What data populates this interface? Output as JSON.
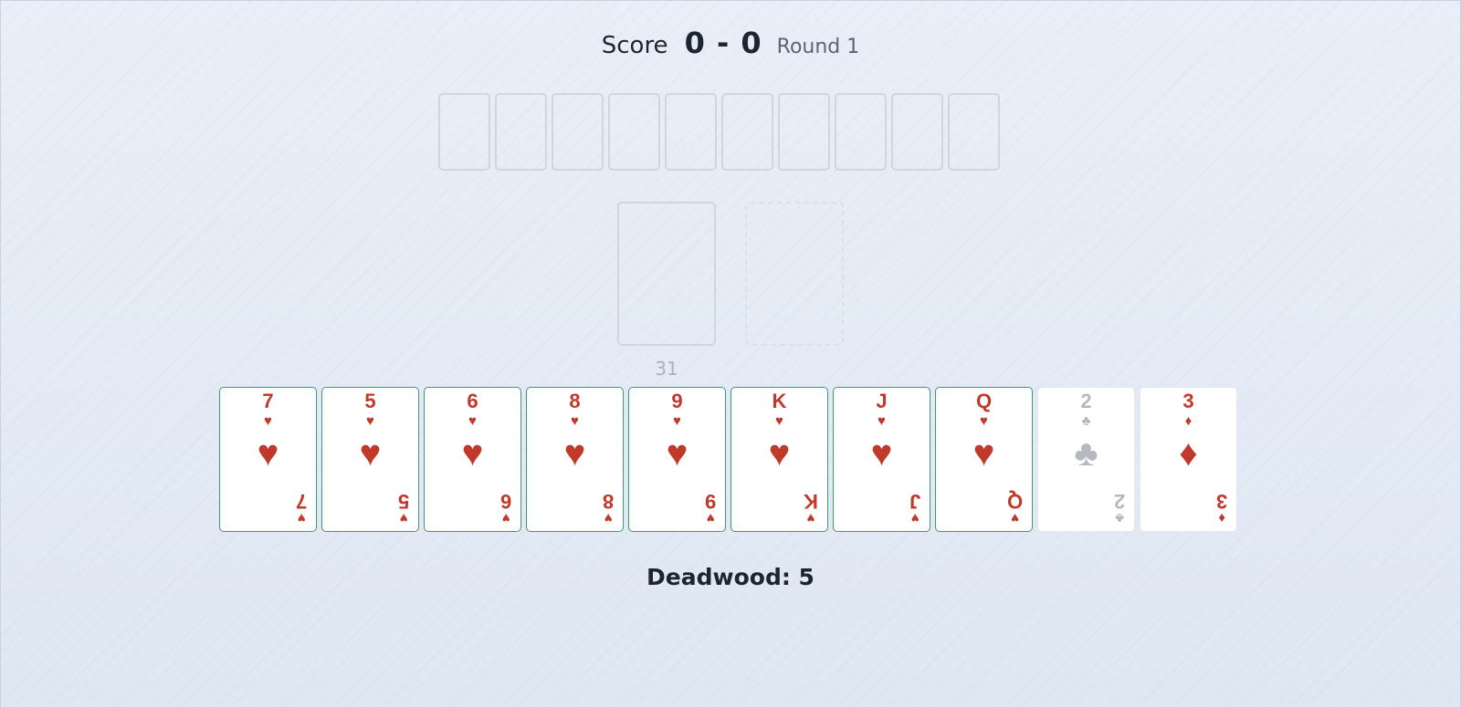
{
  "score": {
    "label": "Score",
    "value": "0 - 0",
    "round": "Round 1"
  },
  "opponent": {
    "hidden_cards": 10
  },
  "stock": {
    "count": "31"
  },
  "discard": {
    "empty": true
  },
  "hand": [
    {
      "rank": "7",
      "suit": "♥",
      "suit_name": "hearts",
      "in_meld": true
    },
    {
      "rank": "5",
      "suit": "♥",
      "suit_name": "hearts",
      "in_meld": true
    },
    {
      "rank": "6",
      "suit": "♥",
      "suit_name": "hearts",
      "in_meld": true
    },
    {
      "rank": "8",
      "suit": "♥",
      "suit_name": "hearts",
      "in_meld": true
    },
    {
      "rank": "9",
      "suit": "♥",
      "suit_name": "hearts",
      "in_meld": true
    },
    {
      "rank": "K",
      "suit": "♥",
      "suit_name": "hearts",
      "in_meld": true
    },
    {
      "rank": "J",
      "suit": "♥",
      "suit_name": "hearts",
      "in_meld": true
    },
    {
      "rank": "Q",
      "suit": "♥",
      "suit_name": "hearts",
      "in_meld": true
    },
    {
      "rank": "2",
      "suit": "♣",
      "suit_name": "clubs",
      "in_meld": false
    },
    {
      "rank": "3",
      "suit": "♦",
      "suit_name": "diamonds",
      "in_meld": false
    }
  ],
  "deadwood": {
    "text": "Deadwood: 5"
  },
  "colors": {
    "red_suit": "#c0392b",
    "black_suit_faded": "#b5b9bf",
    "meld_border": "#3a9a6c"
  }
}
